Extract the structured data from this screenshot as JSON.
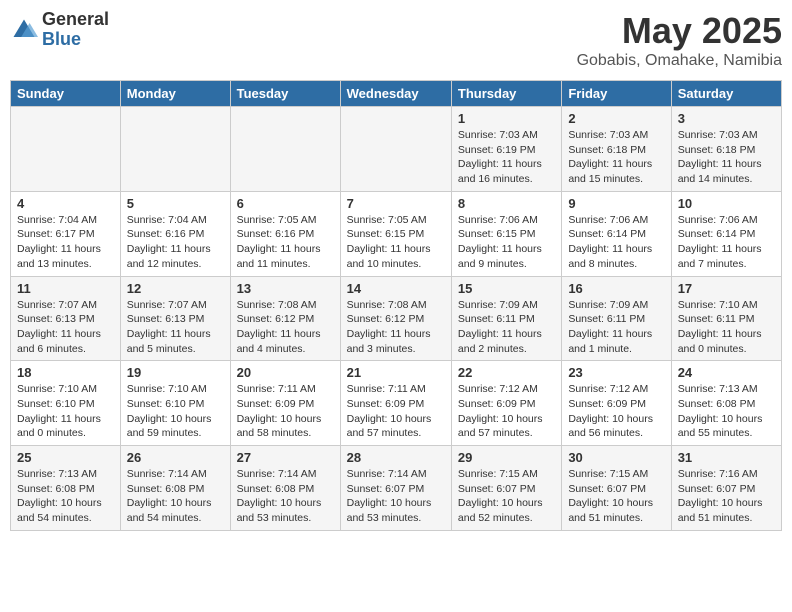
{
  "header": {
    "logo_general": "General",
    "logo_blue": "Blue",
    "month_title": "May 2025",
    "location": "Gobabis, Omahake, Namibia"
  },
  "days_of_week": [
    "Sunday",
    "Monday",
    "Tuesday",
    "Wednesday",
    "Thursday",
    "Friday",
    "Saturday"
  ],
  "weeks": [
    [
      {
        "day": "",
        "info": ""
      },
      {
        "day": "",
        "info": ""
      },
      {
        "day": "",
        "info": ""
      },
      {
        "day": "",
        "info": ""
      },
      {
        "day": "1",
        "info": "Sunrise: 7:03 AM\nSunset: 6:19 PM\nDaylight: 11 hours and 16 minutes."
      },
      {
        "day": "2",
        "info": "Sunrise: 7:03 AM\nSunset: 6:18 PM\nDaylight: 11 hours and 15 minutes."
      },
      {
        "day": "3",
        "info": "Sunrise: 7:03 AM\nSunset: 6:18 PM\nDaylight: 11 hours and 14 minutes."
      }
    ],
    [
      {
        "day": "4",
        "info": "Sunrise: 7:04 AM\nSunset: 6:17 PM\nDaylight: 11 hours and 13 minutes."
      },
      {
        "day": "5",
        "info": "Sunrise: 7:04 AM\nSunset: 6:16 PM\nDaylight: 11 hours and 12 minutes."
      },
      {
        "day": "6",
        "info": "Sunrise: 7:05 AM\nSunset: 6:16 PM\nDaylight: 11 hours and 11 minutes."
      },
      {
        "day": "7",
        "info": "Sunrise: 7:05 AM\nSunset: 6:15 PM\nDaylight: 11 hours and 10 minutes."
      },
      {
        "day": "8",
        "info": "Sunrise: 7:06 AM\nSunset: 6:15 PM\nDaylight: 11 hours and 9 minutes."
      },
      {
        "day": "9",
        "info": "Sunrise: 7:06 AM\nSunset: 6:14 PM\nDaylight: 11 hours and 8 minutes."
      },
      {
        "day": "10",
        "info": "Sunrise: 7:06 AM\nSunset: 6:14 PM\nDaylight: 11 hours and 7 minutes."
      }
    ],
    [
      {
        "day": "11",
        "info": "Sunrise: 7:07 AM\nSunset: 6:13 PM\nDaylight: 11 hours and 6 minutes."
      },
      {
        "day": "12",
        "info": "Sunrise: 7:07 AM\nSunset: 6:13 PM\nDaylight: 11 hours and 5 minutes."
      },
      {
        "day": "13",
        "info": "Sunrise: 7:08 AM\nSunset: 6:12 PM\nDaylight: 11 hours and 4 minutes."
      },
      {
        "day": "14",
        "info": "Sunrise: 7:08 AM\nSunset: 6:12 PM\nDaylight: 11 hours and 3 minutes."
      },
      {
        "day": "15",
        "info": "Sunrise: 7:09 AM\nSunset: 6:11 PM\nDaylight: 11 hours and 2 minutes."
      },
      {
        "day": "16",
        "info": "Sunrise: 7:09 AM\nSunset: 6:11 PM\nDaylight: 11 hours and 1 minute."
      },
      {
        "day": "17",
        "info": "Sunrise: 7:10 AM\nSunset: 6:11 PM\nDaylight: 11 hours and 0 minutes."
      }
    ],
    [
      {
        "day": "18",
        "info": "Sunrise: 7:10 AM\nSunset: 6:10 PM\nDaylight: 11 hours and 0 minutes."
      },
      {
        "day": "19",
        "info": "Sunrise: 7:10 AM\nSunset: 6:10 PM\nDaylight: 10 hours and 59 minutes."
      },
      {
        "day": "20",
        "info": "Sunrise: 7:11 AM\nSunset: 6:09 PM\nDaylight: 10 hours and 58 minutes."
      },
      {
        "day": "21",
        "info": "Sunrise: 7:11 AM\nSunset: 6:09 PM\nDaylight: 10 hours and 57 minutes."
      },
      {
        "day": "22",
        "info": "Sunrise: 7:12 AM\nSunset: 6:09 PM\nDaylight: 10 hours and 57 minutes."
      },
      {
        "day": "23",
        "info": "Sunrise: 7:12 AM\nSunset: 6:09 PM\nDaylight: 10 hours and 56 minutes."
      },
      {
        "day": "24",
        "info": "Sunrise: 7:13 AM\nSunset: 6:08 PM\nDaylight: 10 hours and 55 minutes."
      }
    ],
    [
      {
        "day": "25",
        "info": "Sunrise: 7:13 AM\nSunset: 6:08 PM\nDaylight: 10 hours and 54 minutes."
      },
      {
        "day": "26",
        "info": "Sunrise: 7:14 AM\nSunset: 6:08 PM\nDaylight: 10 hours and 54 minutes."
      },
      {
        "day": "27",
        "info": "Sunrise: 7:14 AM\nSunset: 6:08 PM\nDaylight: 10 hours and 53 minutes."
      },
      {
        "day": "28",
        "info": "Sunrise: 7:14 AM\nSunset: 6:07 PM\nDaylight: 10 hours and 53 minutes."
      },
      {
        "day": "29",
        "info": "Sunrise: 7:15 AM\nSunset: 6:07 PM\nDaylight: 10 hours and 52 minutes."
      },
      {
        "day": "30",
        "info": "Sunrise: 7:15 AM\nSunset: 6:07 PM\nDaylight: 10 hours and 51 minutes."
      },
      {
        "day": "31",
        "info": "Sunrise: 7:16 AM\nSunset: 6:07 PM\nDaylight: 10 hours and 51 minutes."
      }
    ]
  ]
}
